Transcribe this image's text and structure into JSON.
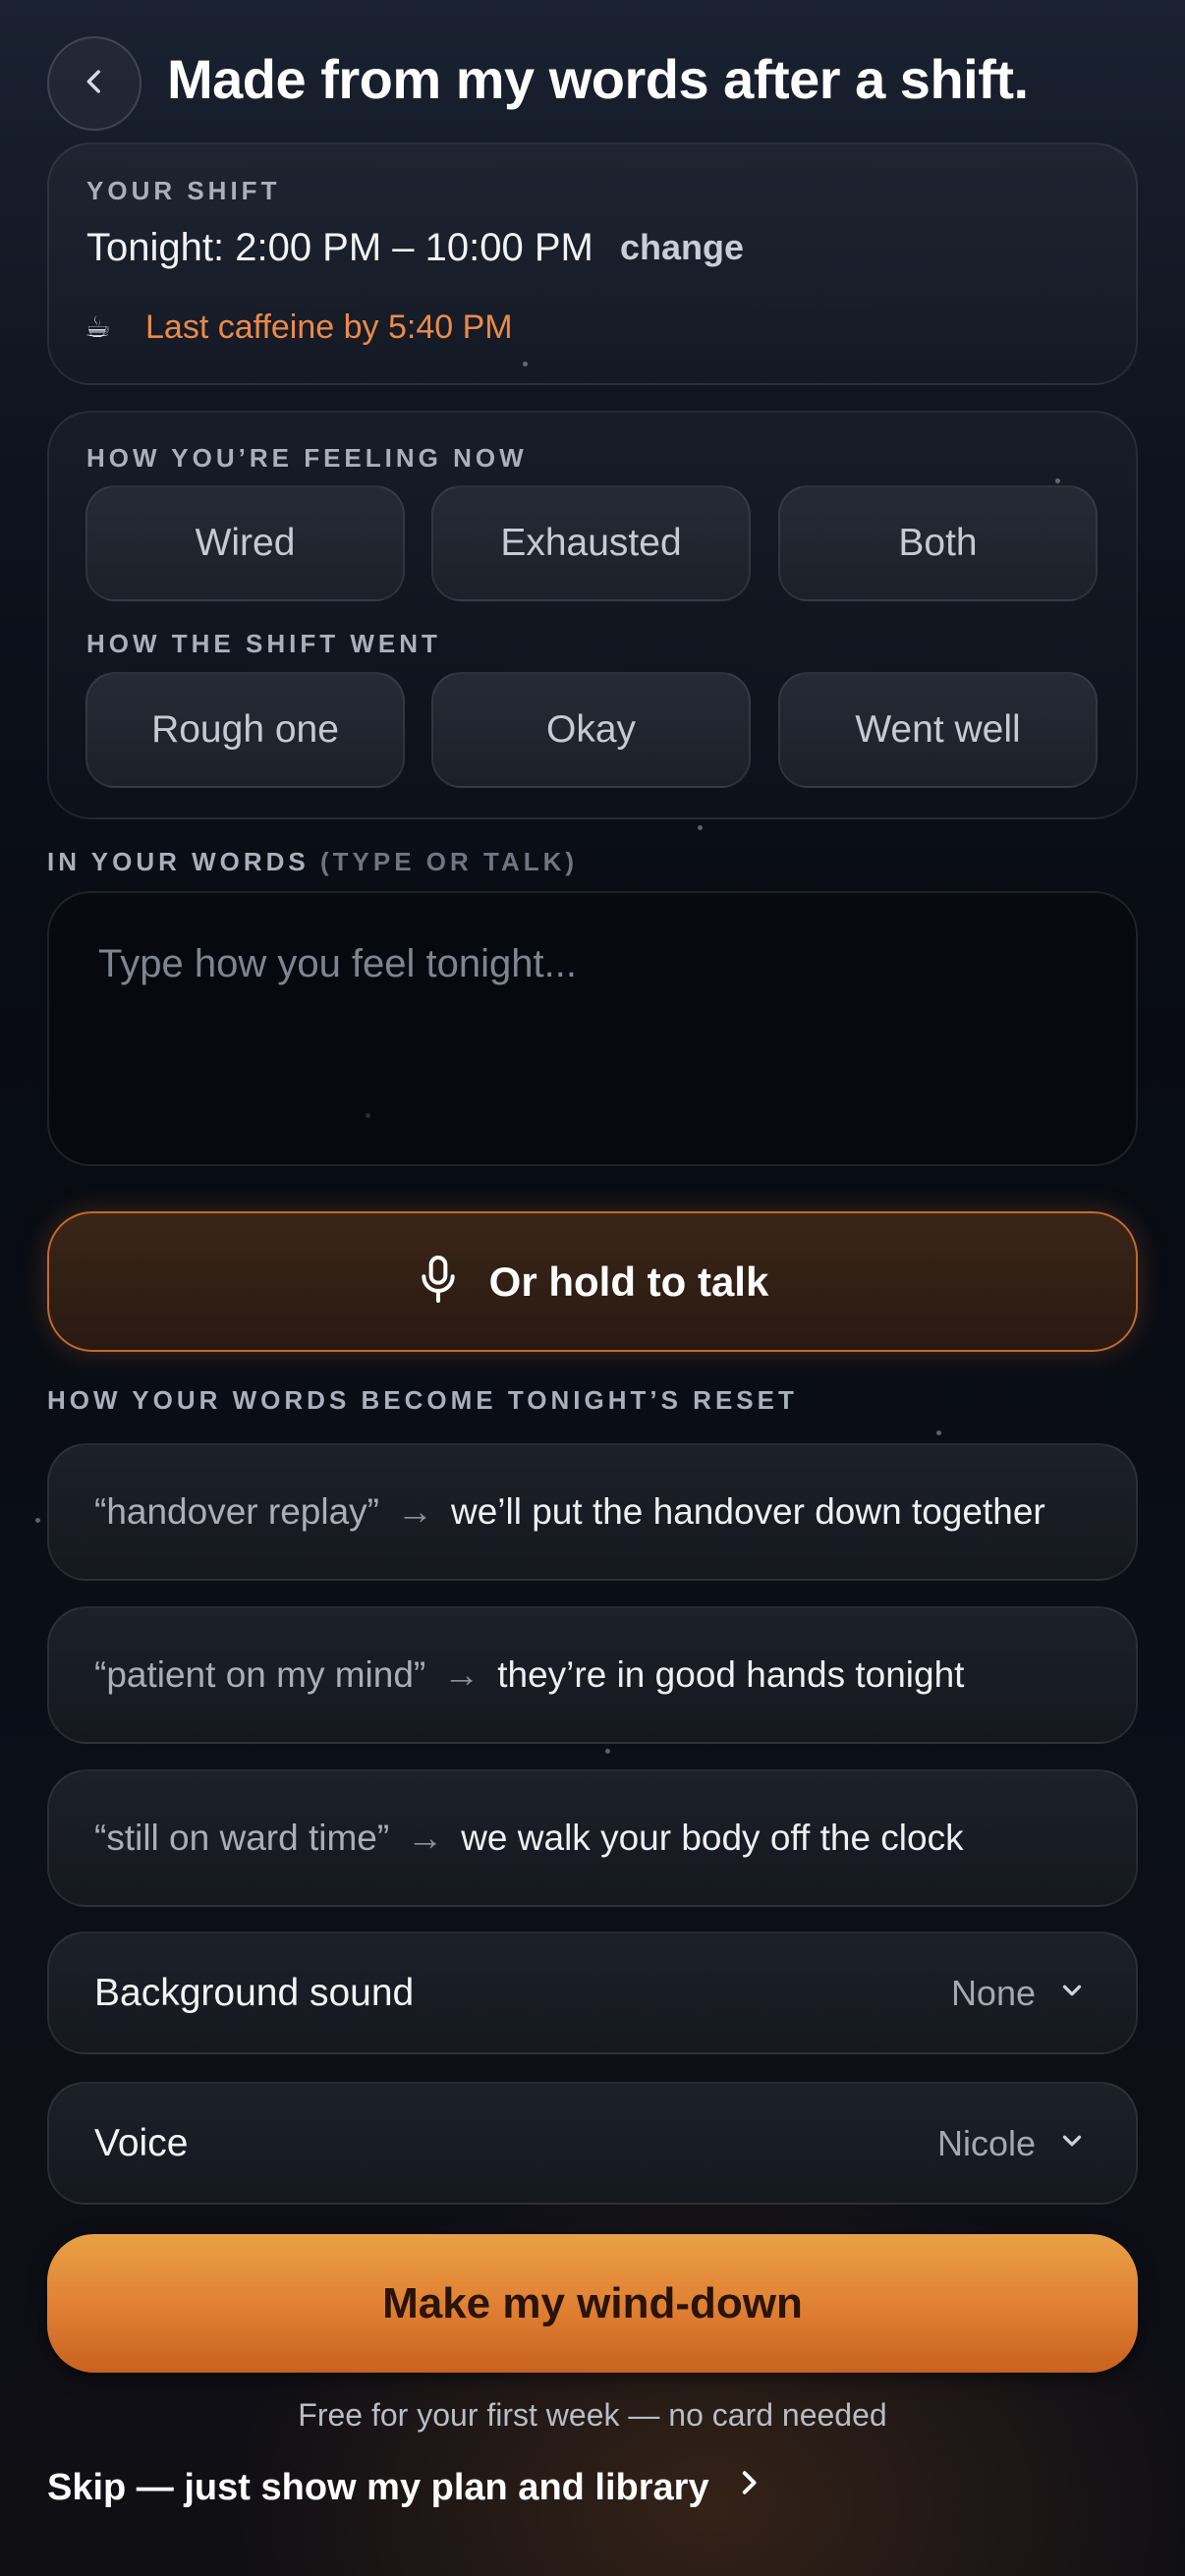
{
  "header": {
    "title": "Made from my words after a shift."
  },
  "shift": {
    "label": "YOUR SHIFT",
    "time": "Tonight: 2:00 PM – 10:00 PM",
    "change_label": "change",
    "caffeine_icon": "☕",
    "caffeine_note": "Last caffeine by 5:40 PM"
  },
  "feeling": {
    "label": "HOW YOU’RE FEELING NOW",
    "options": [
      "Wired",
      "Exhausted",
      "Both"
    ]
  },
  "shift_went": {
    "label": "HOW THE SHIFT WENT",
    "options": [
      "Rough one",
      "Okay",
      "Went well"
    ]
  },
  "words": {
    "label": "IN YOUR WORDS",
    "label_hint": "(TYPE OR TALK)",
    "placeholder": "Type how you feel tonight..."
  },
  "talk": {
    "label": "Or hold to talk"
  },
  "reset": {
    "label": "HOW YOUR WORDS BECOME TONIGHT’S RESET",
    "items": [
      {
        "quote": "“handover replay”",
        "arrow": "→",
        "result": "we’ll put the handover down together"
      },
      {
        "quote": "“patient on my mind”",
        "arrow": "→",
        "result": "they’re in good hands tonight"
      },
      {
        "quote": "“still on ward time”",
        "arrow": "→",
        "result": "we walk your body off the clock"
      }
    ]
  },
  "background_sound": {
    "label": "Background sound",
    "value": "None"
  },
  "voice": {
    "label": "Voice",
    "value": "Nicole"
  },
  "cta": {
    "label": "Make my wind-down",
    "note": "Free for your first week — no card needed"
  },
  "skip": {
    "label": "Skip — just show my plan and library"
  },
  "colors": {
    "accent": "#e07e33",
    "caffeine": "#ec8a4a"
  }
}
